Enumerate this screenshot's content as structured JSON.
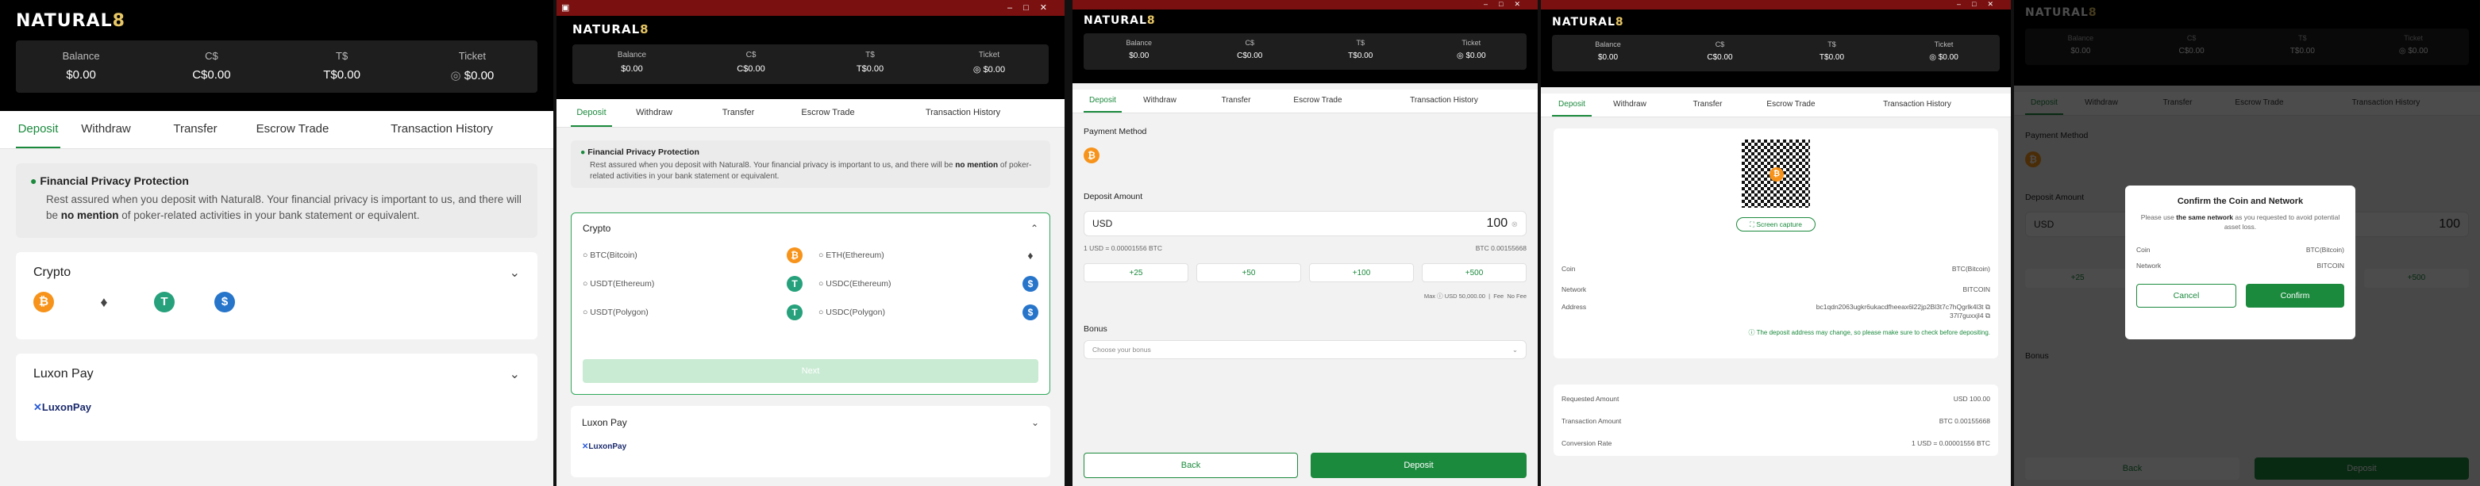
{
  "brand": {
    "name_a": "NATURAL",
    "name_b": "8"
  },
  "balances": [
    {
      "label": "Balance",
      "value": "$0.00"
    },
    {
      "label": "C$",
      "value": "C$0.00"
    },
    {
      "label": "T$",
      "value": "T$0.00"
    },
    {
      "label": "Ticket",
      "value": "$0.00"
    }
  ],
  "tabs": [
    "Deposit",
    "Withdraw",
    "Transfer",
    "Escrow Trade",
    "Transaction History"
  ],
  "privacy": {
    "title": "Financial Privacy Protection",
    "text_a": "Rest assured when you deposit with Natural8. Your financial privacy is important to us, and there will be ",
    "bold": "no mention",
    "text_b": " of poker-related activities in your bank statement or equivalent."
  },
  "crypto": {
    "title": "Crypto",
    "options": [
      {
        "label": "BTC(Bitcoin)",
        "icon": "bitcoin-icon"
      },
      {
        "label": "ETH(Ethereum)",
        "icon": "ethereum-icon"
      },
      {
        "label": "USDT(Ethereum)",
        "icon": "tether-icon"
      },
      {
        "label": "USDC(Ethereum)",
        "icon": "usdc-icon"
      },
      {
        "label": "USDT(Polygon)",
        "icon": "tether-icon"
      },
      {
        "label": "USDC(Polygon)",
        "icon": "usdc-icon"
      }
    ],
    "next": "Next"
  },
  "luxon": {
    "title": "Luxon Pay",
    "logo": "LuxonPay"
  },
  "deposit_form": {
    "method_label": "Payment Method",
    "amount_label": "Deposit Amount",
    "currency": "USD",
    "amount": "100",
    "rate": "1 USD = 0.00001556 BTC",
    "btc_amount": "BTC 0.00155668",
    "quick": [
      "+25",
      "+50",
      "+100",
      "+500"
    ],
    "max_label": "Max",
    "max_value": "USD 50,000.00",
    "fee_label": "Fee",
    "fee_value": "No Fee",
    "bonus_label": "Bonus",
    "bonus_placeholder": "Choose your bonus",
    "back": "Back",
    "deposit": "Deposit"
  },
  "qr_panel": {
    "screen_capture": "Screen capture",
    "coin_label": "Coin",
    "coin_value": "BTC(Bitcoin)",
    "network_label": "Network",
    "network_value": "BITCOIN",
    "address_label": "Address",
    "address_line1": "bc1qdn2063ugkr6ukacdfheeax6l22jp2Bl3t7c7hQgrlk4l3t",
    "address_line2": "37l7guxxjl4",
    "warning": "The deposit address may change, so please make sure to check before depositing.",
    "requested_label": "Requested Amount",
    "requested_value": "USD 100.00",
    "tx_label": "Transaction Amount",
    "tx_value": "BTC 0.00155668",
    "rate_label": "Conversion Rate",
    "rate_value": "1 USD = 0.00001556 BTC"
  },
  "dialog": {
    "title": "Confirm the Coin and Network",
    "text_a": "Please use ",
    "bold": "the same network",
    "text_b": " as you requested to avoid potential asset loss.",
    "coin_label": "Coin",
    "coin_value": "BTC(Bitcoin)",
    "network_label": "Network",
    "network_value": "BITCOIN",
    "cancel": "Cancel",
    "confirm": "Confirm"
  },
  "colors": {
    "green": "#1b8a3d",
    "btc": "#f7931a",
    "usdt": "#26a17b",
    "usdc": "#2775ca",
    "titlebar": "#7a1010"
  }
}
